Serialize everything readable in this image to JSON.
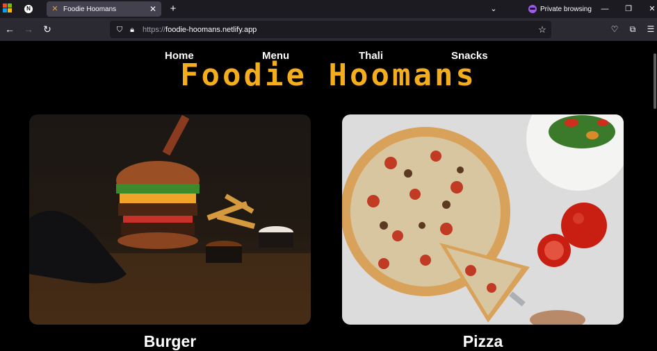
{
  "browser": {
    "tab_title": "Foodie Hoomans",
    "private_label": "Private browsing",
    "url_protocol": "https://",
    "url_host": "foodie-hoomans.netlify.app"
  },
  "site": {
    "title": "Foodie Hoomans",
    "nav": [
      {
        "label": "Home"
      },
      {
        "label": "Menu"
      },
      {
        "label": "Thali"
      },
      {
        "label": "Snacks"
      }
    ],
    "cards": [
      {
        "label": "Burger"
      },
      {
        "label": "Pizza"
      }
    ]
  },
  "colors": {
    "title": "#f4ad1c",
    "page_bg": "#000000",
    "tab_active": "#42414d",
    "toolbar": "#2b2a33"
  }
}
